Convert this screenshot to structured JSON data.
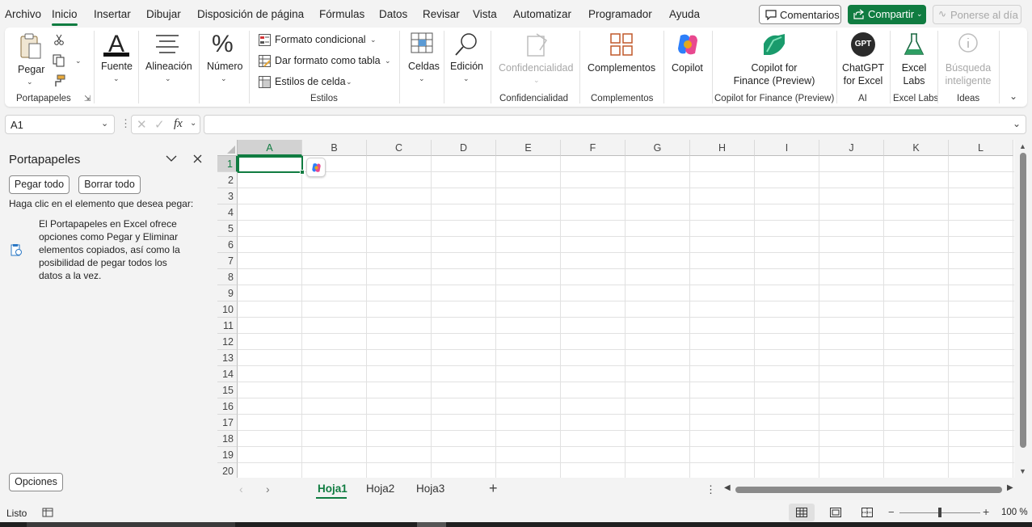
{
  "menu": {
    "items": [
      "Archivo",
      "Inicio",
      "Insertar",
      "Dibujar",
      "Disposición de página",
      "Fórmulas",
      "Datos",
      "Revisar",
      "Vista",
      "Automatizar",
      "Programador",
      "Ayuda"
    ],
    "comments": "Comentarios",
    "share": "Compartir",
    "catchup": "Ponerse al día"
  },
  "ribbon": {
    "paste": "Pegar",
    "font": "Fuente",
    "alignment": "Alineación",
    "number": "Número",
    "conditional_format": "Formato condicional",
    "format_table": "Dar formato como tabla",
    "cell_styles": "Estilos de celda",
    "cells": "Celdas",
    "editing": "Edición",
    "confidential": "Confidencialidad",
    "addins": "Complementos",
    "copilot": "Copilot",
    "copilot_finance_1": "Copilot for",
    "copilot_finance_2": "Finance (Preview)",
    "chatgpt_1": "ChatGPT",
    "chatgpt_2": "for Excel",
    "chatgpt_logo": "GPT",
    "labs_1": "Excel",
    "labs_2": "Labs",
    "smart_1": "Búsqueda",
    "smart_2": "inteligente",
    "groups": {
      "clipboard": "Portapapeles",
      "styles": "Estilos",
      "confidential": "Confidencialidad",
      "addins": "Complementos",
      "copilot_finance": "Copilot for Finance (Preview)",
      "ai": "AI",
      "labs": "Excel Labs",
      "ideas": "Ideas"
    }
  },
  "formula_bar": {
    "name_box": "A1",
    "fx": "fx",
    "value": ""
  },
  "pane": {
    "title": "Portapapeles",
    "paste_all": "Pegar todo",
    "clear_all": "Borrar todo",
    "instruction": "Haga clic en el elemento que desea pegar:",
    "info": "El Portapapeles en Excel ofrece opciones como Pegar y Eliminar elementos copiados, así como la posibilidad de pegar todos los datos a la vez.",
    "options": "Opciones"
  },
  "grid": {
    "columns": [
      "A",
      "B",
      "C",
      "D",
      "E",
      "F",
      "G",
      "H",
      "I",
      "J",
      "K",
      "L"
    ],
    "rows": [
      "1",
      "2",
      "3",
      "4",
      "5",
      "6",
      "7",
      "8",
      "9",
      "10",
      "11",
      "12",
      "13",
      "14",
      "15",
      "16",
      "17",
      "18",
      "19",
      "20"
    ],
    "active_cell": "A1"
  },
  "sheets": {
    "tabs": [
      "Hoja1",
      "Hoja2",
      "Hoja3"
    ],
    "active": "Hoja1"
  },
  "status": {
    "ready": "Listo",
    "zoom": "100 %",
    "zoom_level": 1.0
  },
  "colors": {
    "accent": "#107c41",
    "background": "#f3f3f3"
  }
}
